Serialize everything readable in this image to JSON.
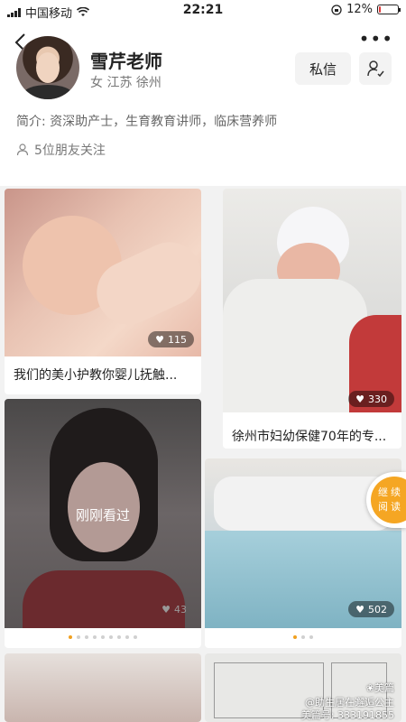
{
  "status": {
    "carrier": "中国移动",
    "time": "22:21",
    "battery": "12%",
    "battery_level": 0.12
  },
  "profile": {
    "name": "雪芹老师",
    "location": "女 江苏 徐州",
    "bio": "简介: 资深助产士，生育教育讲师，临床营养师",
    "friends": "5位朋友关注",
    "message_label": "私信"
  },
  "posts": [
    {
      "likes": "115",
      "title": "我们的美小护教你婴儿抚触..."
    },
    {
      "likes": "330",
      "title": "徐州市妇幼保健70年的专..."
    },
    {
      "likes": "43",
      "seen_label": "刚刚看过"
    },
    {
      "likes": "502"
    }
  ],
  "continue_reading": {
    "line1": "继续",
    "line2": "阅读"
  },
  "watermarks": {
    "app": "美篇",
    "author": "@助生居在邂逅公主",
    "id": "美篇号: 333191855"
  },
  "colors": {
    "accent": "#f5a623"
  }
}
